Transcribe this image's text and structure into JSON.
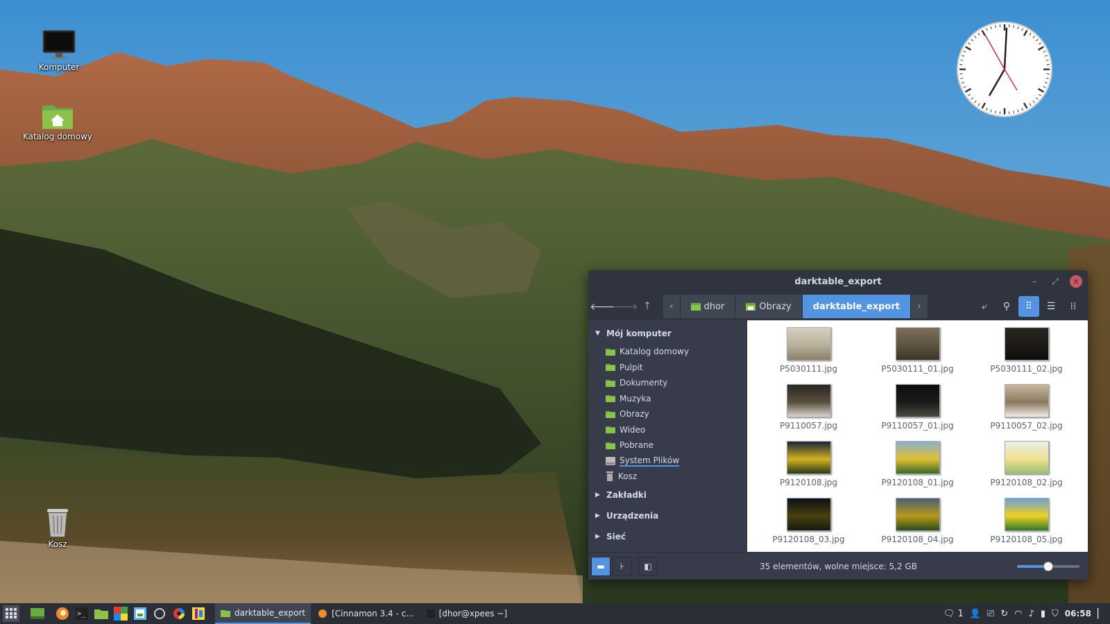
{
  "desktop": {
    "icons": [
      {
        "label": "Komputer",
        "icon": "monitor-icon"
      },
      {
        "label": "Katalog domowy",
        "icon": "home-folder-icon"
      },
      {
        "label": "Kosz",
        "icon": "trash-icon"
      }
    ]
  },
  "window": {
    "title": "darktable_export",
    "controls": {
      "minimize": "–",
      "maximize": "⤢",
      "close": "✕"
    },
    "pathbar": [
      "dhor",
      "Obrazy",
      "darktable_export"
    ],
    "sidebar": {
      "sections": [
        {
          "label": "Mój komputer",
          "expanded": true,
          "items": [
            "Katalog domowy",
            "Pulpit",
            "Dokumenty",
            "Muzyka",
            "Obrazy",
            "Wideo",
            "Pobrane",
            "System Plików",
            "Kosz"
          ]
        },
        {
          "label": "Zakładki",
          "expanded": false
        },
        {
          "label": "Urządzenia",
          "expanded": false
        },
        {
          "label": "Sieć",
          "expanded": false
        }
      ]
    },
    "files": [
      {
        "name": "P5030111.jpg",
        "thumb": "forest-light"
      },
      {
        "name": "P5030111_01.jpg",
        "thumb": "forest-mid"
      },
      {
        "name": "P5030111_02.jpg",
        "thumb": "forest-dark"
      },
      {
        "name": "P9110057.jpg",
        "thumb": "flowers"
      },
      {
        "name": "P9110057_01.jpg",
        "thumb": "flowers-dark"
      },
      {
        "name": "P9110057_02.jpg",
        "thumb": "flowers-bright"
      },
      {
        "name": "P9120108.jpg",
        "thumb": "fountain-dark"
      },
      {
        "name": "P9120108_01.jpg",
        "thumb": "fountain"
      },
      {
        "name": "P9120108_02.jpg",
        "thumb": "fountain-bright"
      },
      {
        "name": "P9120108_03.jpg",
        "thumb": "fountain-night"
      },
      {
        "name": "P9120108_04.jpg",
        "thumb": "fountain-mid"
      },
      {
        "name": "P9120108_05.jpg",
        "thumb": "fountain-vivid"
      }
    ],
    "status": "35 elementów, wolne miejsce: 5,2 GB",
    "zoom_level": 0.5
  },
  "panel": {
    "tasks": [
      {
        "label": "darktable_export",
        "active": true
      },
      {
        "label": "[Cinnamon 3.4 - c...",
        "active": false
      },
      {
        "label": "[dhor@xpees ~]",
        "active": false
      }
    ],
    "tray": {
      "notifications": "1",
      "time": "06:58"
    }
  },
  "colors": {
    "accent": "#5294e2",
    "window_bg": "#383c4a",
    "titlebar": "#2f343f",
    "panel": "#2b2e37"
  }
}
